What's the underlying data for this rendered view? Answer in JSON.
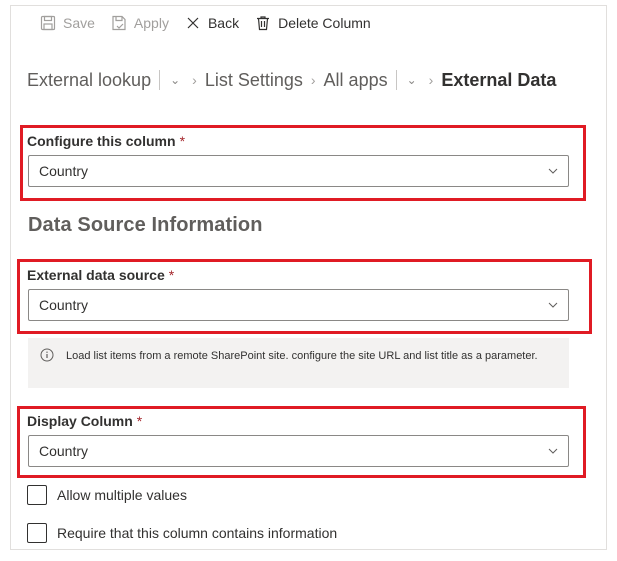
{
  "toolbar": {
    "save_label": "Save",
    "apply_label": "Apply",
    "back_label": "Back",
    "delete_label": "Delete Column"
  },
  "breadcrumb": {
    "items": [
      "External lookup",
      "List Settings",
      "All apps"
    ],
    "current": "External Data"
  },
  "configure": {
    "label": "Configure this column",
    "required_mark": "*",
    "value": "Country"
  },
  "section_title": "Data Source Information",
  "external_source": {
    "label": "External data source",
    "required_mark": "*",
    "value": "Country"
  },
  "info": {
    "text": "Load list items from a remote SharePoint site. configure the site URL and list title as a parameter."
  },
  "display_column": {
    "label": "Display Column",
    "required_mark": "*",
    "value": "Country"
  },
  "options": {
    "allow_multiple": "Allow multiple values",
    "require_info": "Require that this column contains information"
  },
  "colors": {
    "highlight": "#e01b24",
    "required": "#a4262c",
    "info_bg": "#f3f2f1"
  },
  "icons": [
    "save-icon",
    "apply-icon",
    "close-icon",
    "delete-icon",
    "chevron-down-icon",
    "chevron-right-icon",
    "info-icon"
  ]
}
